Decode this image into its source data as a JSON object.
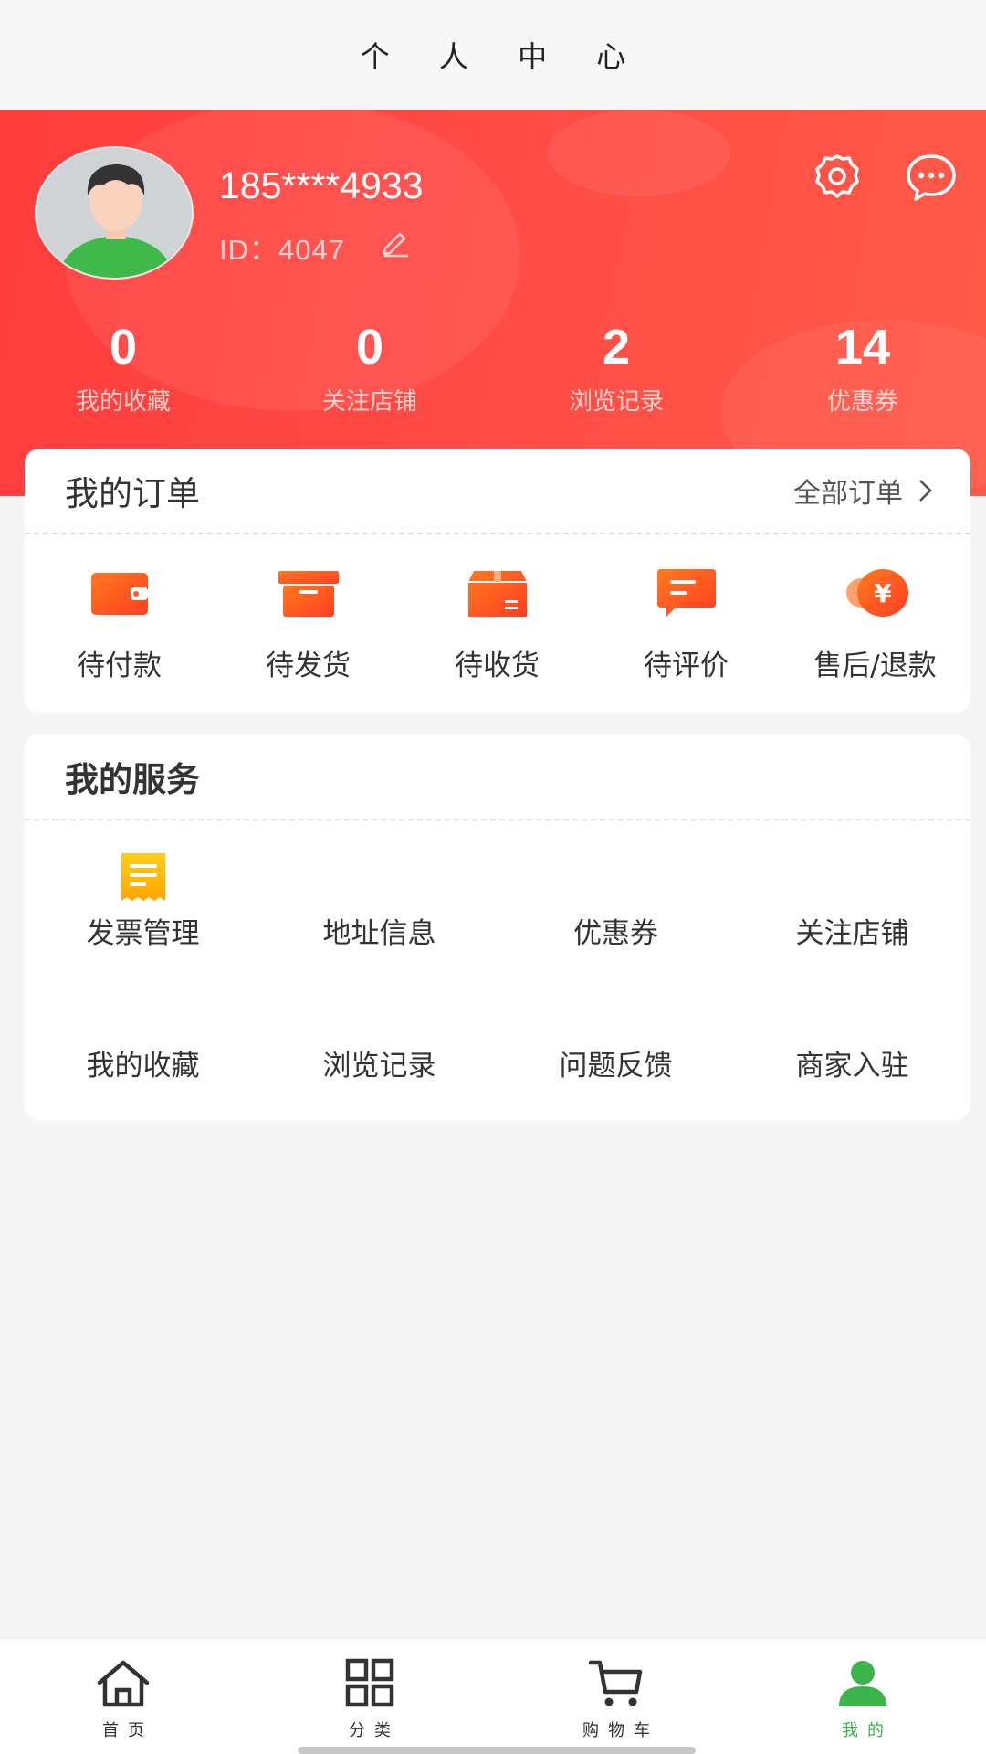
{
  "header": {
    "title": "个 人 中 心"
  },
  "profile": {
    "phone": "185****4933",
    "id_text": "ID：4047"
  },
  "stats": [
    {
      "value": "0",
      "label": "我的收藏"
    },
    {
      "value": "0",
      "label": "关注店铺"
    },
    {
      "value": "2",
      "label": "浏览记录"
    },
    {
      "value": "14",
      "label": "优惠券"
    }
  ],
  "orders": {
    "title": "我的订单",
    "all_label": "全部订单",
    "items": [
      {
        "label": "待付款",
        "icon": "wallet-icon"
      },
      {
        "label": "待发货",
        "icon": "box-icon"
      },
      {
        "label": "待收货",
        "icon": "package-icon"
      },
      {
        "label": "待评价",
        "icon": "comment-icon"
      },
      {
        "label": "售后/退款",
        "icon": "refund-icon"
      }
    ]
  },
  "services": {
    "title": "我的服务",
    "items": [
      {
        "label": "发票管理",
        "icon": "invoice-icon"
      },
      {
        "label": "地址信息"
      },
      {
        "label": "优惠券"
      },
      {
        "label": "关注店铺"
      },
      {
        "label": "我的收藏"
      },
      {
        "label": "浏览记录"
      },
      {
        "label": "问题反馈"
      },
      {
        "label": "商家入驻"
      }
    ]
  },
  "tabbar": {
    "items": [
      {
        "label": "首页",
        "icon": "home-icon"
      },
      {
        "label": "分类",
        "icon": "grid-icon"
      },
      {
        "label": "购物车",
        "icon": "cart-icon"
      },
      {
        "label": "我的",
        "icon": "user-icon",
        "active": true
      }
    ],
    "active_color": "#3cb44a"
  },
  "colors": {
    "accent": "#ff4343",
    "icon_orange": "#ff5a1f",
    "invoice_yellow": "#ffb400"
  }
}
